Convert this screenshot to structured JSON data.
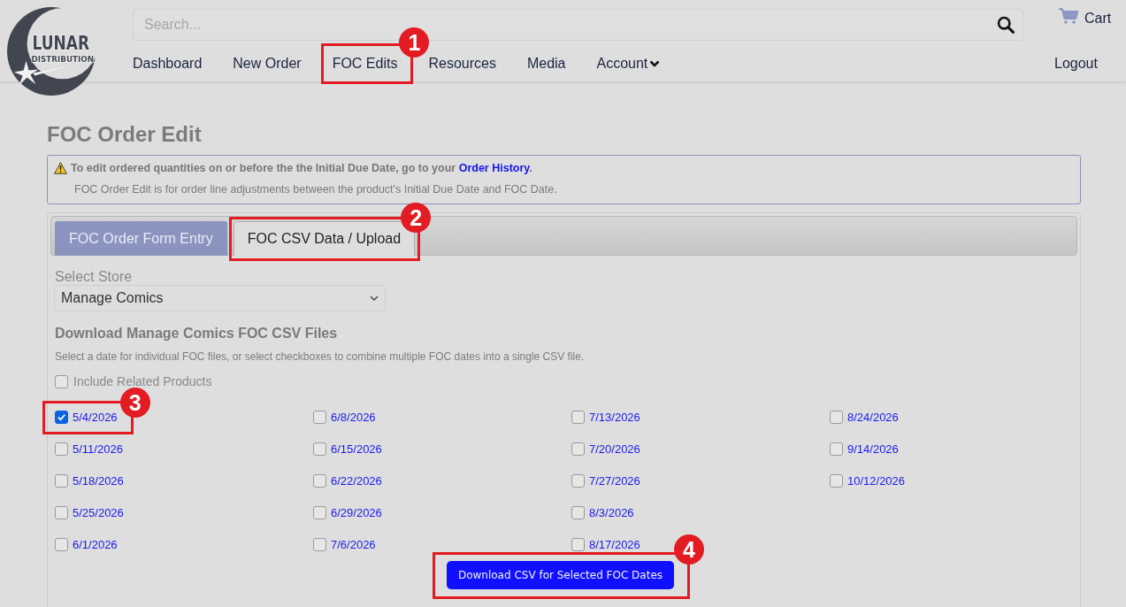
{
  "header": {
    "logo": {
      "line_1": "LUNAR",
      "line_2": "DISTRIBUTION"
    },
    "search": {
      "placeholder": "Search..."
    },
    "cart": {
      "label": "Cart"
    },
    "nav": [
      {
        "label": "Dashboard",
        "dropdown": false
      },
      {
        "label": "New Order",
        "dropdown": false
      },
      {
        "label": "FOC Edits",
        "dropdown": false,
        "callout": "1"
      },
      {
        "label": "Resources",
        "dropdown": false
      },
      {
        "label": "Media",
        "dropdown": false
      },
      {
        "label": "Account",
        "dropdown": true
      }
    ],
    "logout": {
      "label": "Logout"
    }
  },
  "page": {
    "title": "FOC Order Edit",
    "notice": {
      "text": "To edit ordered quantities on or before the the Initial Due Date, go to your",
      "link": "Order History",
      "after": ".",
      "note": "FOC Order Edit is for order line adjustments between the product's Initial Due Date and FOC Date."
    }
  },
  "tabs": [
    {
      "label": "FOC Order Form Entry",
      "selected": false
    },
    {
      "label": "FOC CSV Data / Upload",
      "selected": true,
      "callout": "2"
    }
  ],
  "store": {
    "label": "Select Store",
    "value": "Manage Comics"
  },
  "downloads": {
    "heading": "Download Manage Comics FOC CSV Files",
    "description": "Select a date for individual FOC files, or select checkboxes to combine multiple FOC dates into a single CSV file.",
    "include_related": {
      "label": "Include Related Products",
      "checked": false
    },
    "dates": [
      {
        "label": "5/4/2026",
        "checked": true,
        "callout": "3"
      },
      {
        "label": "5/11/2026",
        "checked": false
      },
      {
        "label": "5/18/2026",
        "checked": false
      },
      {
        "label": "5/25/2026",
        "checked": false
      },
      {
        "label": "6/1/2026",
        "checked": false
      },
      {
        "label": "6/8/2026",
        "checked": false
      },
      {
        "label": "6/15/2026",
        "checked": false
      },
      {
        "label": "6/22/2026",
        "checked": false
      },
      {
        "label": "6/29/2026",
        "checked": false
      },
      {
        "label": "7/6/2026",
        "checked": false
      },
      {
        "label": "7/13/2026",
        "checked": false
      },
      {
        "label": "7/20/2026",
        "checked": false
      },
      {
        "label": "7/27/2026",
        "checked": false
      },
      {
        "label": "8/3/2026",
        "checked": false
      },
      {
        "label": "8/17/2026",
        "checked": false
      },
      {
        "label": "8/24/2026",
        "checked": false
      },
      {
        "label": "9/14/2026",
        "checked": false
      },
      {
        "label": "10/12/2026",
        "checked": false
      }
    ],
    "button": {
      "label": "Download CSV for Selected FOC Dates",
      "callout": "4"
    }
  }
}
